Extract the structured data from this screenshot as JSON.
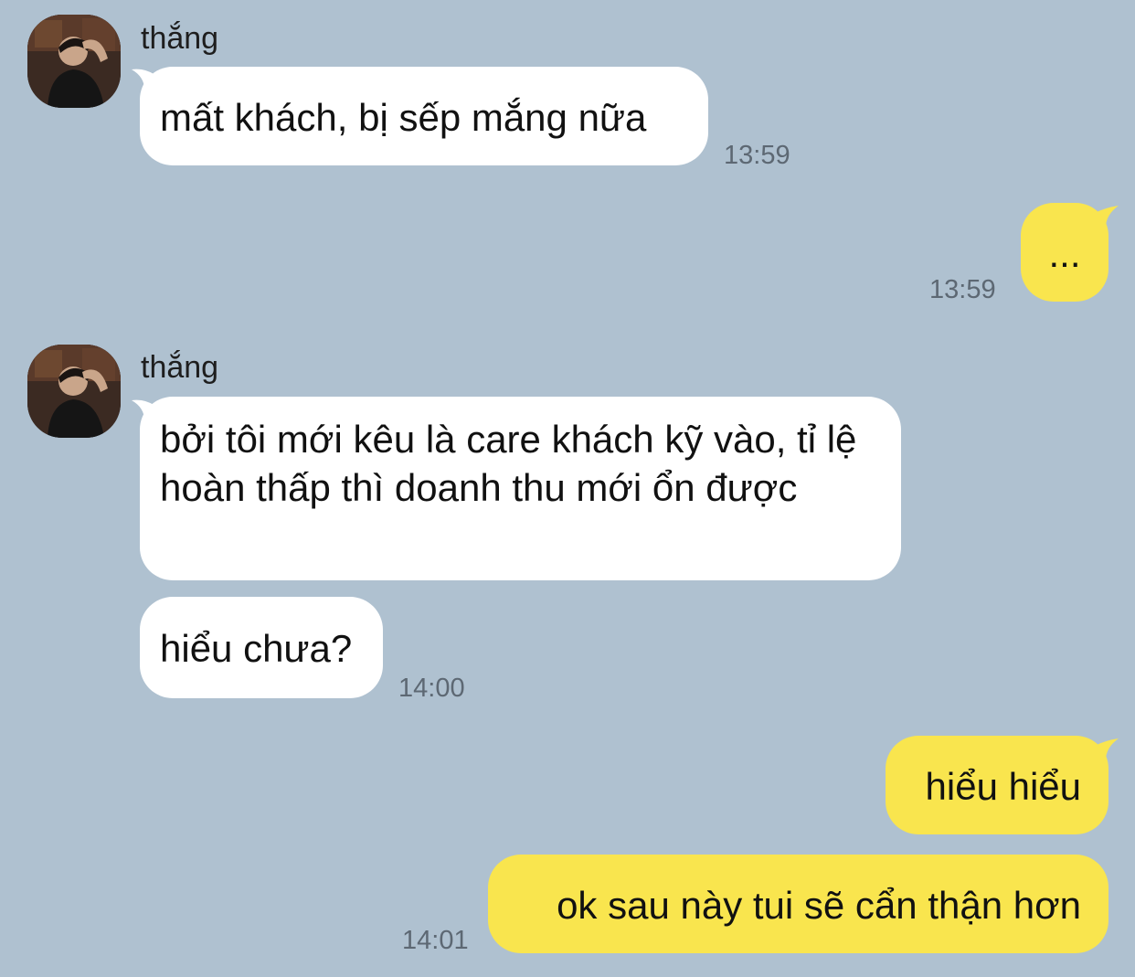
{
  "contact": {
    "name": "thắng"
  },
  "messages": [
    {
      "side": "in",
      "text": "mất khách, bị sếp mắng nữa",
      "time": "13:59"
    },
    {
      "side": "out",
      "text": "...",
      "time": "13:59"
    },
    {
      "side": "in",
      "text": "bởi tôi mới kêu là care khách kỹ vào, tỉ lệ hoàn thấp thì doanh thu mới ổn được",
      "time": ""
    },
    {
      "side": "in",
      "text": "hiểu chưa?",
      "time": "14:00"
    },
    {
      "side": "out",
      "text": "hiểu hiểu",
      "time": ""
    },
    {
      "side": "out",
      "text": "ok sau này tui sẽ cẩn thận hơn",
      "time": "14:01"
    }
  ],
  "colors": {
    "background": "#afc1d0",
    "incoming_bubble": "#ffffff",
    "outgoing_bubble": "#f9e54e",
    "timestamp": "#5d6873"
  },
  "icons": {
    "avatar": "profile-photo"
  }
}
